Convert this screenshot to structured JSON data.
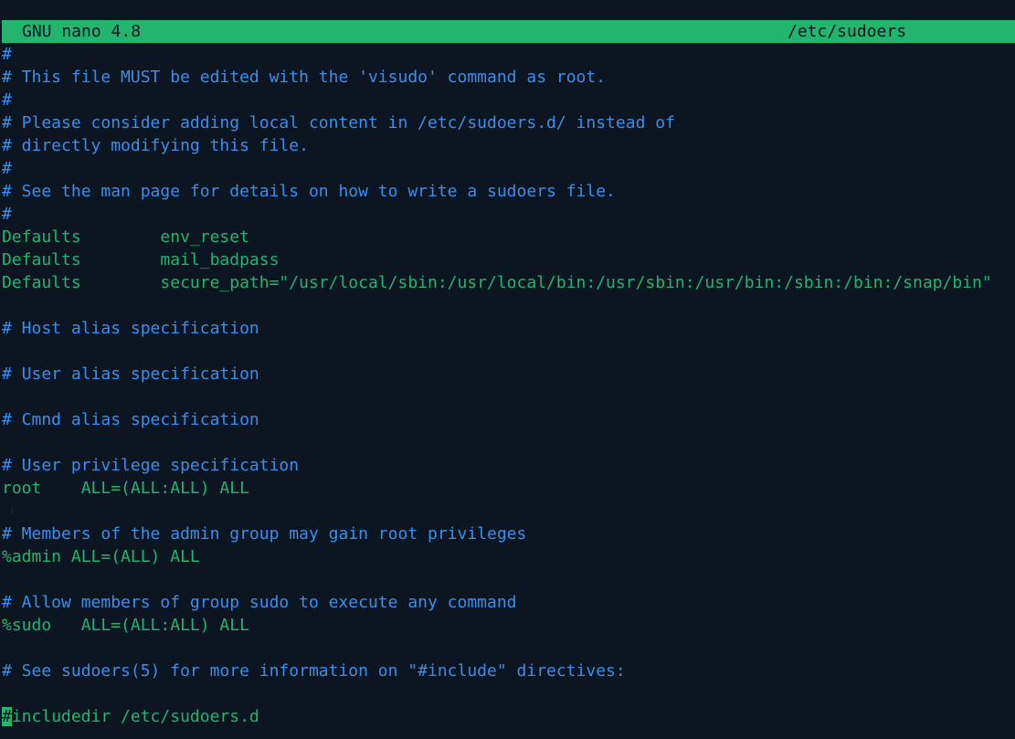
{
  "titlebar": {
    "app": "GNU nano 4.8",
    "file": "/etc/sudoers"
  },
  "lines": [
    {
      "type": "comment",
      "text": "#"
    },
    {
      "type": "comment",
      "text": "# This file MUST be edited with the 'visudo' command as root."
    },
    {
      "type": "comment",
      "text": "#"
    },
    {
      "type": "comment",
      "text": "# Please consider adding local content in /etc/sudoers.d/ instead of"
    },
    {
      "type": "comment",
      "text": "# directly modifying this file."
    },
    {
      "type": "comment",
      "text": "#"
    },
    {
      "type": "comment",
      "text": "# See the man page for details on how to write a sudoers file."
    },
    {
      "type": "comment",
      "text": "#"
    },
    {
      "type": "directive",
      "text": "Defaults        env_reset"
    },
    {
      "type": "directive",
      "text": "Defaults        mail_badpass"
    },
    {
      "type": "directive",
      "text": "Defaults        secure_path=\"/usr/local/sbin:/usr/local/bin:/usr/sbin:/usr/bin:/sbin:/bin:/snap/bin\""
    },
    {
      "type": "blank",
      "text": ""
    },
    {
      "type": "comment",
      "text": "# Host alias specification"
    },
    {
      "type": "blank",
      "text": ""
    },
    {
      "type": "comment",
      "text": "# User alias specification"
    },
    {
      "type": "blank",
      "text": ""
    },
    {
      "type": "comment",
      "text": "# Cmnd alias specification"
    },
    {
      "type": "blank",
      "text": ""
    },
    {
      "type": "comment",
      "text": "# User privilege specification"
    },
    {
      "type": "directive",
      "text": "root    ALL=(ALL:ALL) ALL"
    },
    {
      "type": "blank",
      "text": ""
    },
    {
      "type": "comment",
      "text": "# Members of the admin group may gain root privileges"
    },
    {
      "type": "directive",
      "text": "%admin ALL=(ALL) ALL"
    },
    {
      "type": "blank",
      "text": ""
    },
    {
      "type": "comment",
      "text": "# Allow members of group sudo to execute any command"
    },
    {
      "type": "directive",
      "text": "%sudo   ALL=(ALL:ALL) ALL"
    },
    {
      "type": "blank",
      "text": ""
    },
    {
      "type": "comment",
      "text": "# See sudoers(5) for more information on \"#include\" directives:"
    },
    {
      "type": "blank",
      "text": ""
    },
    {
      "type": "cursorline",
      "cursor_char": "#",
      "text": "includedir /etc/sudoers.d"
    }
  ],
  "colors": {
    "background": "#0c1522",
    "comment": "#3b8eea",
    "directive": "#23b56d",
    "titlebar": "#23b56d"
  }
}
